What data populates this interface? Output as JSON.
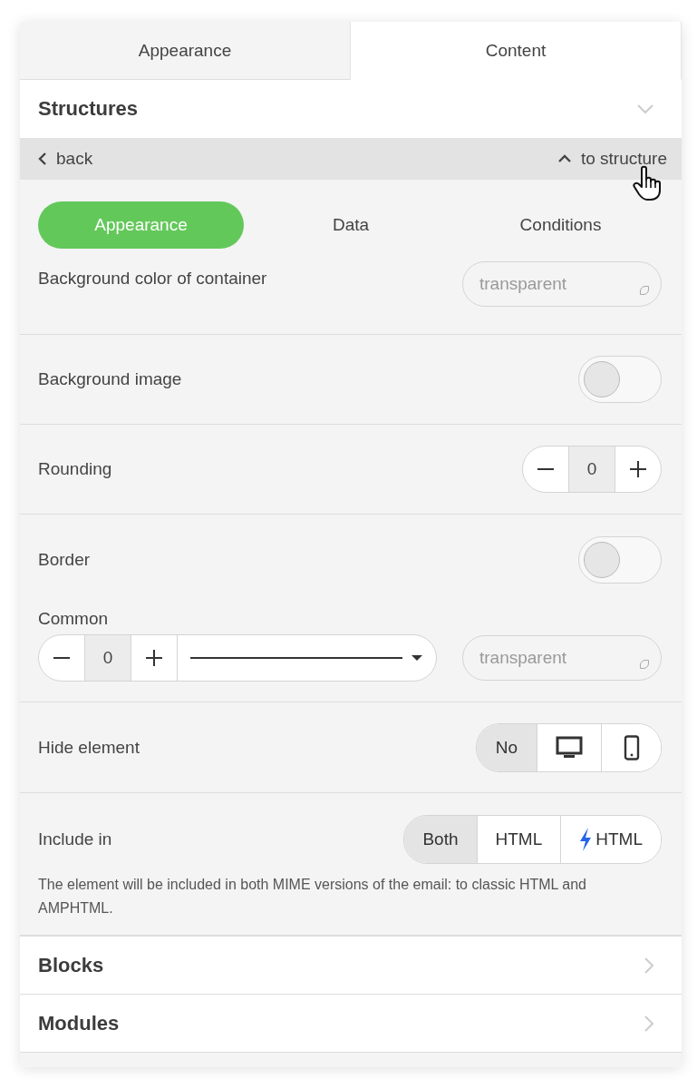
{
  "tabs": [
    {
      "label": "Appearance",
      "selected": false
    },
    {
      "label": "Content",
      "selected": true
    }
  ],
  "section": {
    "title": "Structures"
  },
  "nav": {
    "back": "back",
    "up": "to structure"
  },
  "subtabs": [
    {
      "label": "Appearance",
      "selected": true
    },
    {
      "label": "Data",
      "selected": false
    },
    {
      "label": "Conditions",
      "selected": false
    }
  ],
  "settings": [
    {
      "kind": "color",
      "label": "Background color of container",
      "placeholder": "transparent"
    },
    {
      "kind": "toggle",
      "label": "Background image",
      "on": false
    },
    {
      "kind": "stepper",
      "label": "Rounding",
      "value": "0"
    },
    {
      "kind": "border",
      "label": "Border",
      "on": false,
      "sublabel": "Common",
      "value": "0",
      "placeholder": "transparent"
    },
    {
      "kind": "segmented",
      "label": "Hide element",
      "options": [
        {
          "kind": "text",
          "label": "No",
          "selected": true
        },
        {
          "kind": "desktop",
          "selected": false
        },
        {
          "kind": "mobile",
          "selected": false
        }
      ]
    },
    {
      "kind": "segmented",
      "label": "Include in",
      "options": [
        {
          "kind": "text",
          "label": "Both",
          "selected": true
        },
        {
          "kind": "text",
          "label": "HTML",
          "selected": false
        },
        {
          "kind": "amp",
          "label": "HTML",
          "selected": false
        }
      ],
      "note": "The element will be included in both MIME versions of the email: to classic HTML and AMPHTML."
    }
  ],
  "footer_sections": [
    {
      "title": "Blocks"
    },
    {
      "title": "Modules"
    }
  ]
}
